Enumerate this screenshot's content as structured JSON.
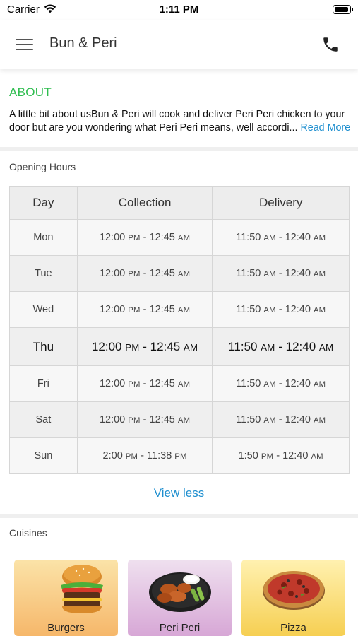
{
  "status_bar": {
    "carrier": "Carrier",
    "time": "1:11 PM"
  },
  "nav": {
    "title": "Bun & Peri",
    "menu_icon": "hamburger-menu-icon",
    "phone_icon": "phone-icon"
  },
  "about": {
    "heading": "ABOUT",
    "text": "A little bit about usBun & Peri will cook and deliver Peri Peri chicken to your door but are you wondering what Peri Peri means, well accordi...",
    "read_more": "Read More"
  },
  "hours": {
    "heading": "Opening Hours",
    "columns": [
      "Day",
      "Collection",
      "Delivery"
    ],
    "rows": [
      {
        "day": "Mon",
        "collection": [
          "12:00",
          "PM",
          "12:45",
          "AM"
        ],
        "delivery": [
          "11:50",
          "AM",
          "12:40",
          "AM"
        ]
      },
      {
        "day": "Tue",
        "collection": [
          "12:00",
          "PM",
          "12:45",
          "AM"
        ],
        "delivery": [
          "11:50",
          "AM",
          "12:40",
          "AM"
        ]
      },
      {
        "day": "Wed",
        "collection": [
          "12:00",
          "PM",
          "12:45",
          "AM"
        ],
        "delivery": [
          "11:50",
          "AM",
          "12:40",
          "AM"
        ]
      },
      {
        "day": "Thu",
        "collection": [
          "12:00",
          "PM",
          "12:45",
          "AM"
        ],
        "delivery": [
          "11:50",
          "AM",
          "12:40",
          "AM"
        ]
      },
      {
        "day": "Fri",
        "collection": [
          "12:00",
          "PM",
          "12:45",
          "AM"
        ],
        "delivery": [
          "11:50",
          "AM",
          "12:40",
          "AM"
        ]
      },
      {
        "day": "Sat",
        "collection": [
          "12:00",
          "PM",
          "12:45",
          "AM"
        ],
        "delivery": [
          "11:50",
          "AM",
          "12:40",
          "AM"
        ]
      },
      {
        "day": "Sun",
        "collection": [
          "2:00",
          "PM",
          "11:38",
          "PM"
        ],
        "delivery": [
          "1:50",
          "PM",
          "12:40",
          "AM"
        ]
      }
    ],
    "view_less": "View less"
  },
  "cuisines": {
    "heading": "Cuisines",
    "items": [
      {
        "label": "Burgers",
        "icon": "burger-icon"
      },
      {
        "label": "Peri Peri",
        "icon": "chicken-wings-icon"
      },
      {
        "label": "Pizza",
        "icon": "pizza-icon"
      }
    ]
  },
  "colors": {
    "accent_green": "#2ebd4f",
    "link_blue": "#1f8fcf"
  }
}
